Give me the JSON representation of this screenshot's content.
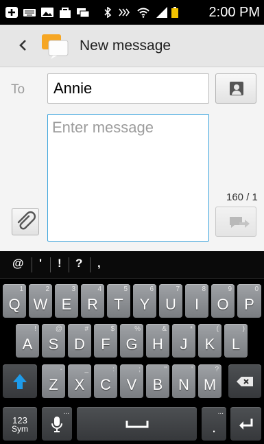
{
  "status_bar": {
    "time": "2:00 PM",
    "icons": [
      "add-notification-icon",
      "keyboard-icon",
      "gallery-icon",
      "bag-icon",
      "messages-icon",
      "bluetooth-icon",
      "nfc-icon",
      "wifi-icon",
      "signal-icon",
      "battery-icon"
    ]
  },
  "action_bar": {
    "back_icon": "chevron-left-icon",
    "app_icon": "messaging-app-icon",
    "title": "New message"
  },
  "compose": {
    "to_label": "To",
    "recipient": "Annie",
    "contact_button_icon": "contact-card-icon",
    "message_placeholder": "Enter message",
    "message_value": "",
    "char_counter": "160 / 1",
    "attach_icon": "paperclip-icon",
    "send_icon": "send-message-icon"
  },
  "keyboard": {
    "quick_symbols": [
      "@",
      "'",
      "!",
      "?",
      ","
    ],
    "row1": [
      {
        "main": "Q",
        "hint": "1"
      },
      {
        "main": "W",
        "hint": "2"
      },
      {
        "main": "E",
        "hint": "3"
      },
      {
        "main": "R",
        "hint": "4"
      },
      {
        "main": "T",
        "hint": "5"
      },
      {
        "main": "Y",
        "hint": "6"
      },
      {
        "main": "U",
        "hint": "7"
      },
      {
        "main": "I",
        "hint": "8"
      },
      {
        "main": "O",
        "hint": "9"
      },
      {
        "main": "P",
        "hint": "0"
      }
    ],
    "row2": [
      {
        "main": "A",
        "hint": "!"
      },
      {
        "main": "S",
        "hint": "@"
      },
      {
        "main": "D",
        "hint": "#"
      },
      {
        "main": "F",
        "hint": "$"
      },
      {
        "main": "G",
        "hint": "%"
      },
      {
        "main": "H",
        "hint": "&"
      },
      {
        "main": "J",
        "hint": "*"
      },
      {
        "main": "K",
        "hint": "("
      },
      {
        "main": "L",
        "hint": ")"
      }
    ],
    "row3": [
      {
        "main": "Z",
        "hint": "-"
      },
      {
        "main": "X",
        "hint": "_"
      },
      {
        "main": "C",
        "hint": ":"
      },
      {
        "main": "V",
        "hint": ";"
      },
      {
        "main": "B",
        "hint": "\""
      },
      {
        "main": "N",
        "hint": "'"
      },
      {
        "main": "M",
        "hint": "?"
      }
    ],
    "sym_key": {
      "line1": "123",
      "line2": "Sym"
    },
    "period_key": {
      "main": ".",
      "hint": "..."
    },
    "shift_color": "#1e9be9"
  }
}
